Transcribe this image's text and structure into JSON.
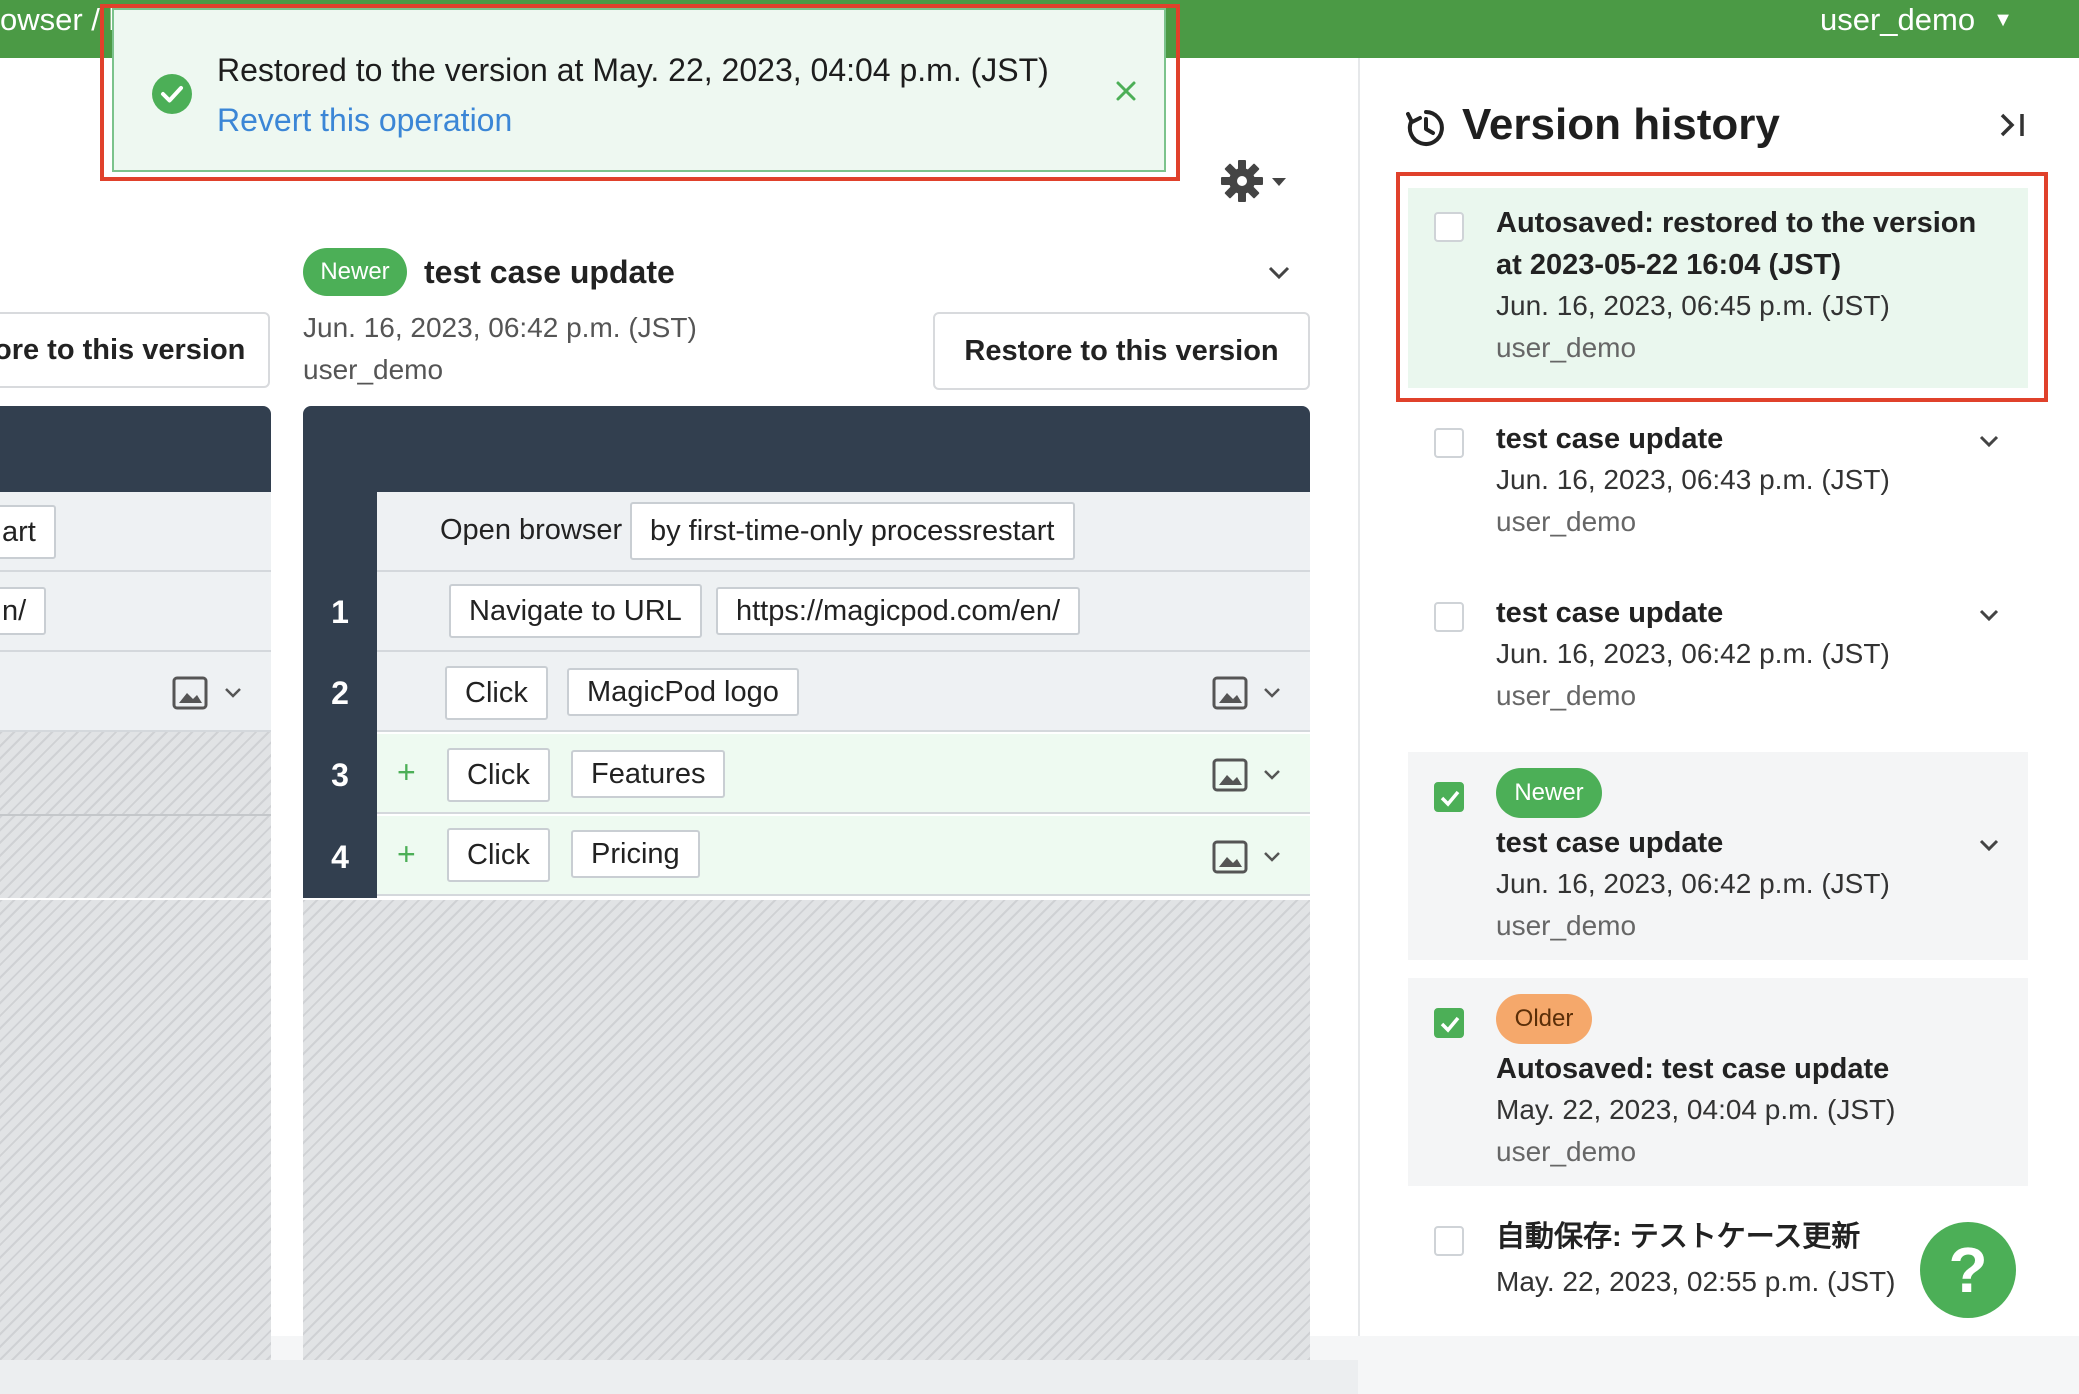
{
  "topbar": {
    "breadcrumb": "owser / history feature (History View)",
    "user": "user_demo"
  },
  "toast": {
    "message": "Restored to the version at May. 22, 2023, 04:04 p.m. (JST)",
    "revert_link": "Revert this operation"
  },
  "compare": {
    "left": {
      "restore_label": "ore to this version",
      "rows": [
        "art",
        "n/"
      ]
    },
    "right": {
      "badge": "Newer",
      "title": "test case update",
      "date": "Jun. 16, 2023, 06:42 p.m. (JST)",
      "user": "user_demo",
      "restore_label": "Restore to this version",
      "header_step": {
        "command": "Open browser",
        "arg": "by first-time-only processrestart"
      },
      "steps": [
        {
          "num": "1",
          "command": "Navigate to URL",
          "arg": "https://magicpod.com/en/",
          "added": false
        },
        {
          "num": "2",
          "command": "Click",
          "arg": "MagicPod logo",
          "added": false
        },
        {
          "num": "3",
          "command": "Click",
          "arg": "Features",
          "added": true
        },
        {
          "num": "4",
          "command": "Click",
          "arg": "Pricing",
          "added": true
        }
      ],
      "added_marker": "+"
    }
  },
  "history": {
    "title": "Version history",
    "items": [
      {
        "title_line1": "Autosaved: restored to the version",
        "title_line2": "at 2023-05-22 16:04 (JST)",
        "date": "Jun. 16, 2023, 06:45 p.m. (JST)",
        "user": "user_demo",
        "checked": false,
        "highlighted": true
      },
      {
        "title": "test case update",
        "date": "Jun. 16, 2023, 06:43 p.m. (JST)",
        "user": "user_demo",
        "checked": false
      },
      {
        "title": "test case update",
        "date": "Jun. 16, 2023, 06:42 p.m. (JST)",
        "user": "user_demo",
        "checked": false
      },
      {
        "badge": "Newer",
        "title": "test case update",
        "date": "Jun. 16, 2023, 06:42 p.m. (JST)",
        "user": "user_demo",
        "checked": true
      },
      {
        "badge": "Older",
        "title": "Autosaved: test case update",
        "date": "May. 22, 2023, 04:04 p.m. (JST)",
        "user": "user_demo",
        "checked": true
      },
      {
        "title": "自動保存: テストケース更新",
        "date": "May. 22, 2023, 02:55 p.m. (JST)",
        "checked": false
      }
    ]
  },
  "help_label": "?",
  "colors": {
    "brand_green": "#4b9a45",
    "highlight_red": "#e0412b",
    "header_navy": "#323f4f",
    "link_blue": "#3b86d6",
    "older_orange": "#f5a86b"
  }
}
